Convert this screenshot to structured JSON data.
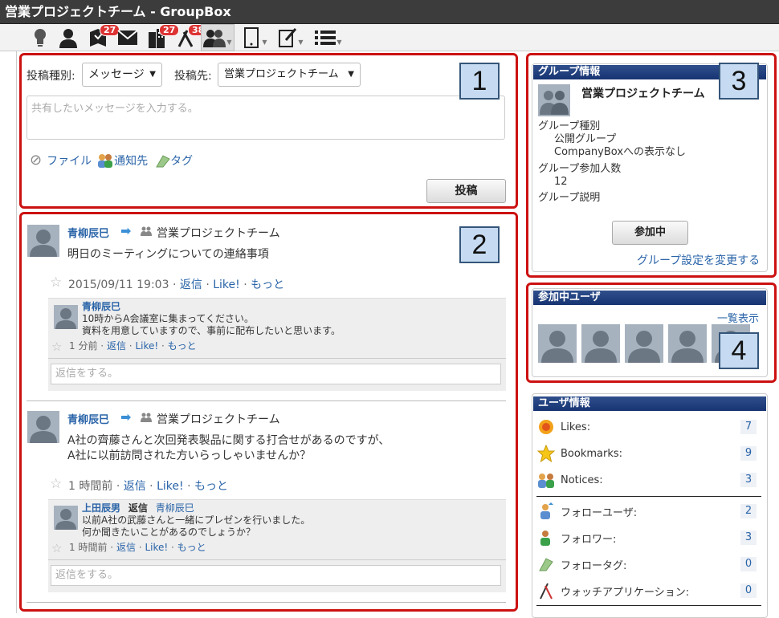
{
  "window": {
    "title": "営業プロジェクトチーム - GroupBox"
  },
  "toolbar": {
    "badges": {
      "docs": "27",
      "buildings": "27",
      "tools": "38"
    }
  },
  "post_form": {
    "type_label": "投稿種別:",
    "type_value": "メッセージ",
    "dest_label": "投稿先:",
    "dest_value": "営業プロジェクトチーム",
    "placeholder": "共有したいメッセージを入力する。",
    "file_label": "ファイル",
    "notify_label": "通知先",
    "tag_label": "タグ",
    "submit_label": "投稿"
  },
  "annotations": {
    "n1": "1",
    "n2": "2",
    "n3": "3",
    "n4": "4"
  },
  "common": {
    "arrow": "➡",
    "dot": "·"
  },
  "feed": [
    {
      "author": "青柳辰巳",
      "group": "営業プロジェクトチーム",
      "text1": "明日のミーティングについての連絡事項",
      "text2": "",
      "time": "2015/09/11 19:03",
      "reply": "返信",
      "like": "Like!",
      "more": "もっと",
      "comment": {
        "author": "青柳辰巳",
        "prefix": "",
        "to": "",
        "line1": "10時からA会議室に集まってください。",
        "line2": "資料を用意していますので、事前に配布したいと思います。",
        "time": "1 分前",
        "reply": "返信",
        "like": "Like!",
        "more": "もっと"
      },
      "reply_placeholder": "返信をする。"
    },
    {
      "author": "青柳辰巳",
      "group": "営業プロジェクトチーム",
      "text1": "A社の齊藤さんと次回発表製品に関する打合せがあるのですが、",
      "text2": "A社に以前訪問された方いらっしゃいませんか？",
      "time": "1 時間前",
      "reply": "返信",
      "like": "Like!",
      "more": "もっと",
      "comment": {
        "author": "上田辰男",
        "prefix": "返信",
        "to": "青柳辰巳",
        "line1": "以前A社の武藤さんと一緒にプレゼンを行いました。",
        "line2": "何か聞きたいことがあるのでしょうか？",
        "time": "1 時間前",
        "reply": "返信",
        "like": "Like!",
        "more": "もっと"
      },
      "reply_placeholder": "返信をする。"
    }
  ],
  "group_info": {
    "header": "グループ情報",
    "name": "営業プロジェクトチーム",
    "kind_label": "グループ種別",
    "kind_value1": "公開グループ",
    "kind_value2": "CompanyBoxへの表示なし",
    "members_label": "グループ参加人数",
    "members_value": "12",
    "desc_label": "グループ説明",
    "join_button": "参加中",
    "settings_link": "グループ設定を変更する"
  },
  "members": {
    "header": "参加中ユーザ",
    "list_link": "一覧表示"
  },
  "user_info": {
    "header": "ユーザ情報",
    "stats": [
      {
        "icon": "flower-icon",
        "label": "Likes:",
        "count": "7"
      },
      {
        "icon": "star-icon",
        "label": "Bookmarks:",
        "count": "9"
      },
      {
        "icon": "people-icon",
        "label": "Notices:",
        "count": "3"
      },
      {
        "icon": "follow-user-icon",
        "label": "フォローユーザ:",
        "count": "2"
      },
      {
        "icon": "follower-icon",
        "label": "フォロワー:",
        "count": "3"
      },
      {
        "icon": "tag-icon",
        "label": "フォロータグ:",
        "count": "0"
      },
      {
        "icon": "watch-icon",
        "label": "ウォッチアプリケーション:",
        "count": "0"
      }
    ]
  },
  "colors": {
    "accent": "#cc1111",
    "link": "#2a64a8",
    "header_blue": "#1d3a78"
  }
}
